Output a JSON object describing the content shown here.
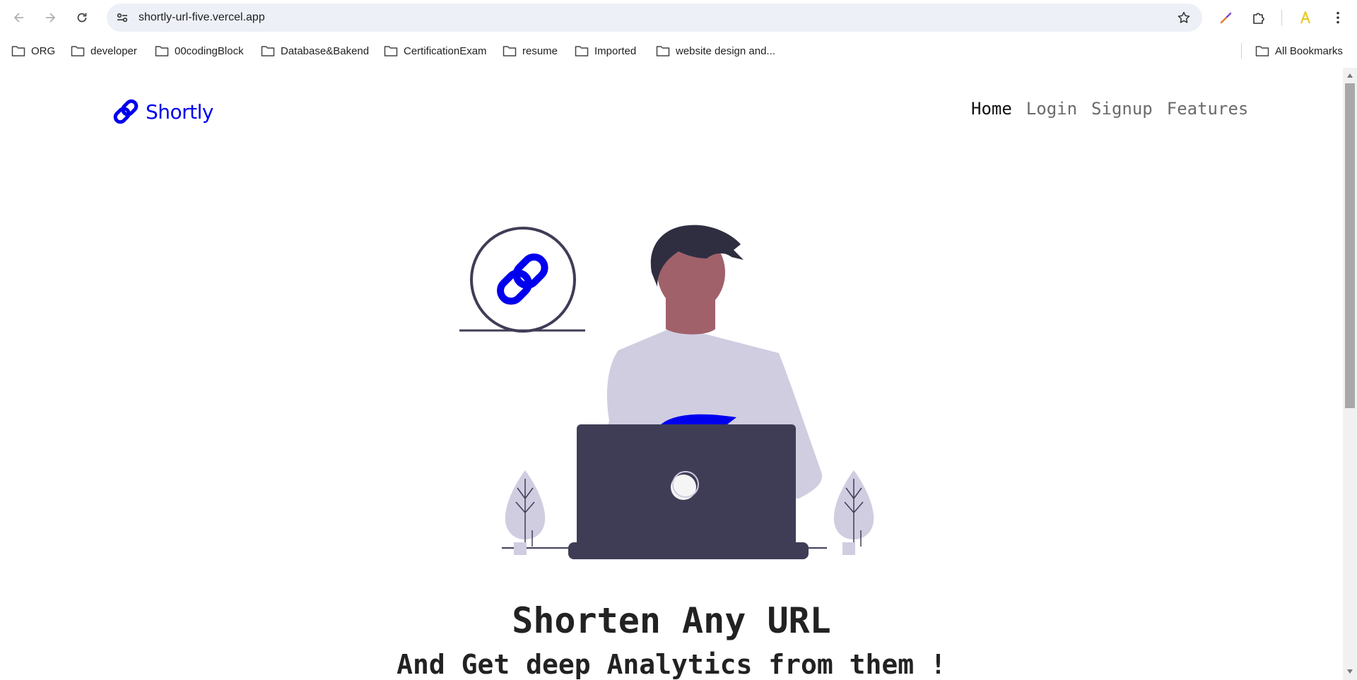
{
  "browser": {
    "url": "shortly-url-five.vercel.app",
    "bookmarks": [
      {
        "label": "ORG"
      },
      {
        "label": "developer"
      },
      {
        "label": "00codingBlock"
      },
      {
        "label": "Database&Bakend"
      },
      {
        "label": "CertificationExam"
      },
      {
        "label": "resume"
      },
      {
        "label": "Imported"
      },
      {
        "label": "website design and..."
      }
    ],
    "all_bookmarks": "All Bookmarks"
  },
  "site": {
    "brand": "Shortly",
    "brand_color": "#0000ee",
    "nav": [
      {
        "label": "Home",
        "active": true
      },
      {
        "label": "Login",
        "active": false
      },
      {
        "label": "Signup",
        "active": false
      },
      {
        "label": "Features",
        "active": false
      }
    ],
    "hero": {
      "title": "Shorten Any URL",
      "subtitle": "And Get deep Analytics from them !"
    }
  }
}
